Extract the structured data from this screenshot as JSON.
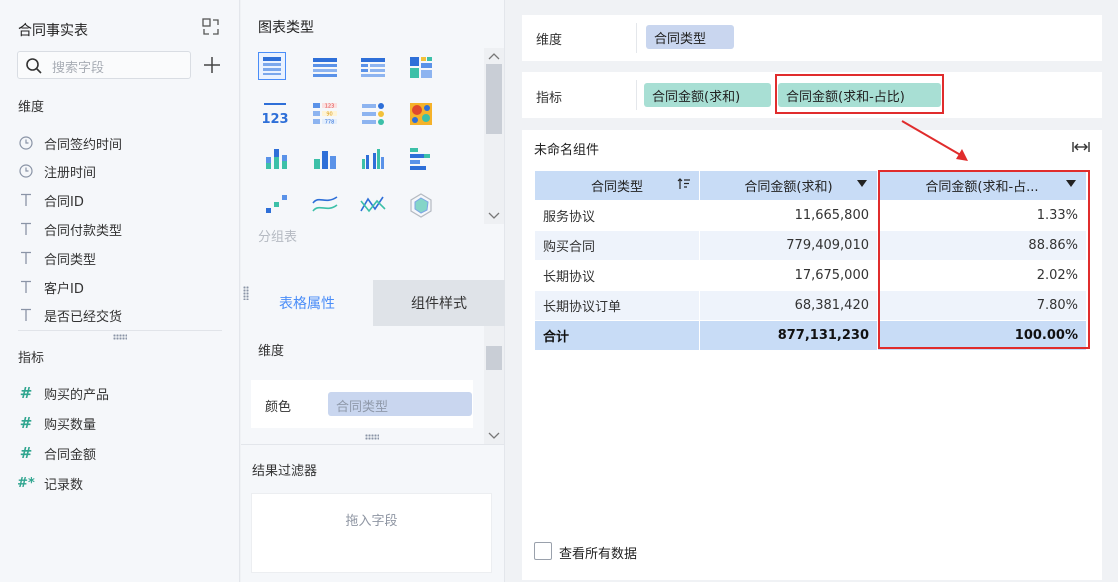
{
  "left": {
    "title": "合同事实表",
    "search_placeholder": "搜索字段",
    "dimension_label": "维度",
    "dimensions": [
      {
        "label": "合同签约时间",
        "icon": "clock-icon"
      },
      {
        "label": "注册时间",
        "icon": "clock-icon"
      },
      {
        "label": "合同ID",
        "icon": "text-type-icon"
      },
      {
        "label": "合同付款类型",
        "icon": "text-type-icon"
      },
      {
        "label": "合同类型",
        "icon": "text-type-icon"
      },
      {
        "label": "客户ID",
        "icon": "text-type-icon"
      },
      {
        "label": "是否已经交货",
        "icon": "text-type-icon"
      }
    ],
    "metric_label": "指标",
    "metrics": [
      {
        "label": "购买的产品",
        "icon": "hash-icon",
        "glyph": "#"
      },
      {
        "label": "购买数量",
        "icon": "hash-icon",
        "glyph": "#"
      },
      {
        "label": "合同金额",
        "icon": "hash-icon",
        "glyph": "#"
      },
      {
        "label": "记录数",
        "icon": "hash-count-icon",
        "glyph": "#*"
      }
    ]
  },
  "middle": {
    "chart_type_title": "图表类型",
    "group_table_label": "分组表",
    "tabs": {
      "active": "表格属性",
      "inactive": "组件样式"
    },
    "dimension_label": "维度",
    "color_label": "颜色",
    "color_field": "合同类型",
    "filter_title": "结果过滤器",
    "filter_placeholder": "拖入字段"
  },
  "right": {
    "dimension_slot_label": "维度",
    "dimension_field": "合同类型",
    "metric_slot_label": "指标",
    "metric_field_1": "合同金额(求和)",
    "metric_field_2": "合同金额(求和-占比)",
    "widget_title": "未命名组件",
    "table": {
      "headers": [
        "合同类型",
        "合同金额(求和)",
        "合同金额(求和-占..."
      ],
      "rows": [
        [
          "服务协议",
          "11,665,800",
          "1.33%"
        ],
        [
          "购买合同",
          "779,409,010",
          "88.86%"
        ],
        [
          "长期协议",
          "17,675,000",
          "2.02%"
        ],
        [
          "长期协议订单",
          "68,381,420",
          "7.80%"
        ]
      ],
      "total": [
        "合计",
        "877,131,230",
        "100.00%"
      ]
    },
    "view_all_label": "查看所有数据",
    "highlight_color": "#e02c2c"
  }
}
